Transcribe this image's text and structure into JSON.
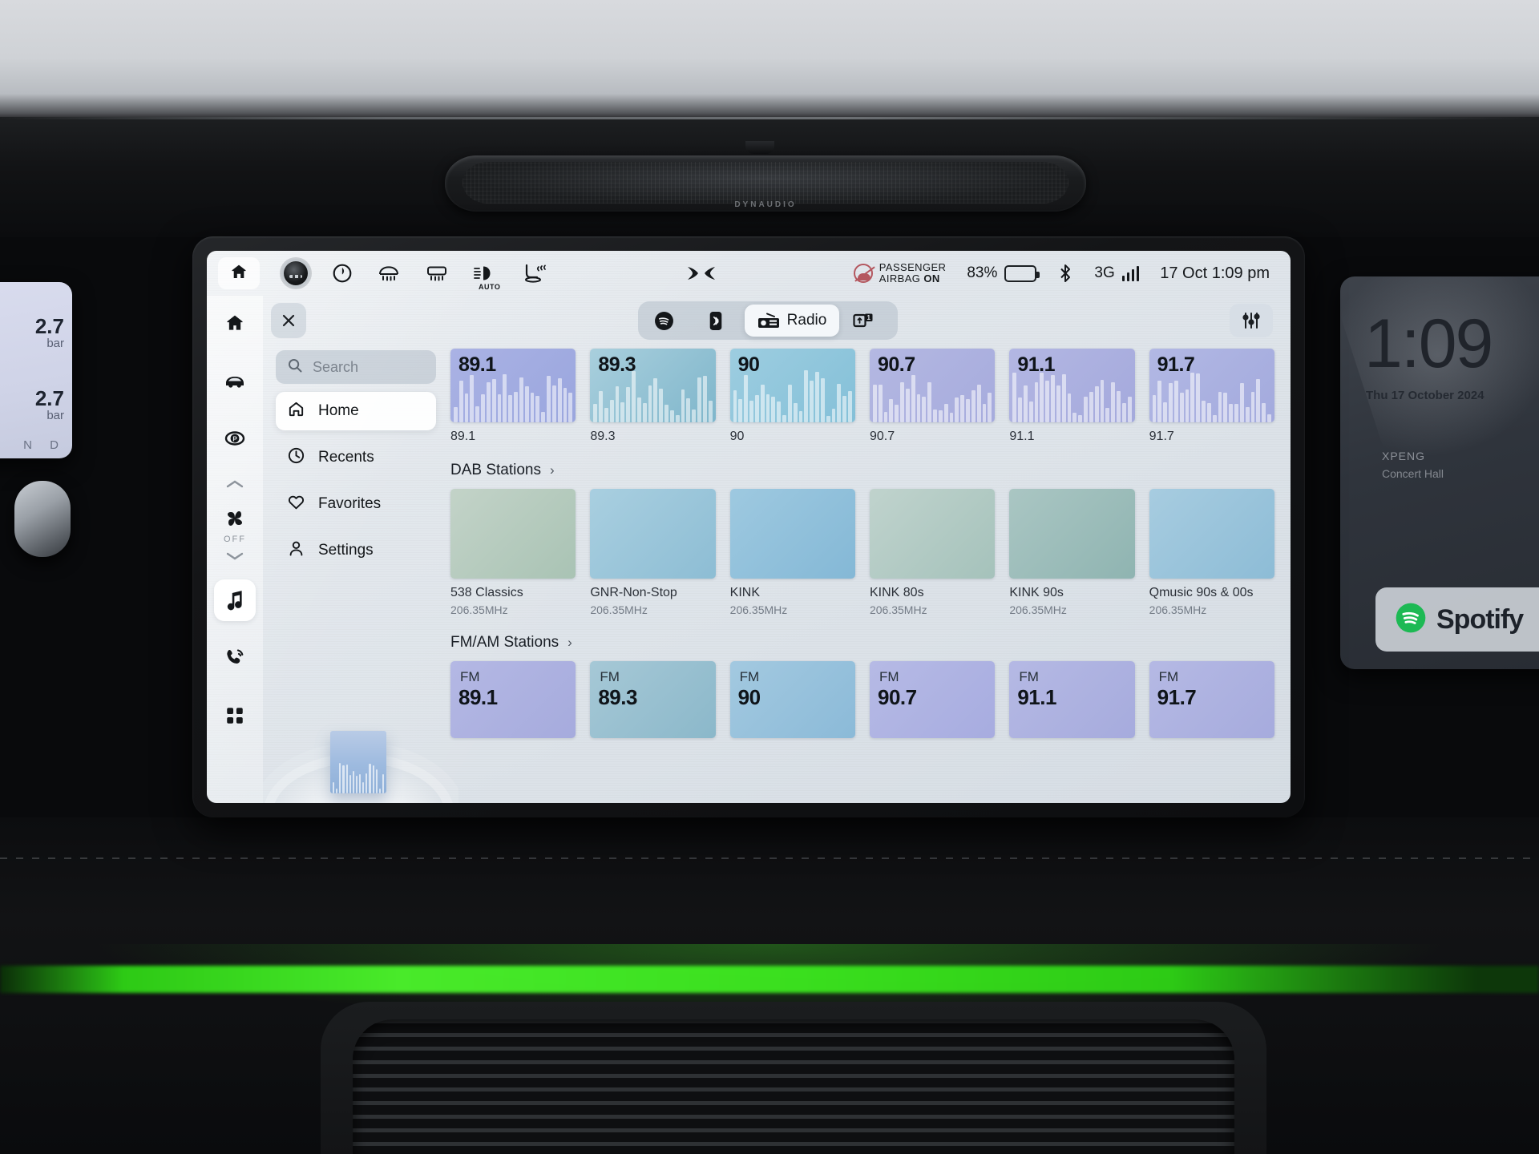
{
  "cabin": {
    "speaker_brand": "DYNAUDIO",
    "cluster": {
      "tpms_front": "2.7",
      "tpms_front_unit": "bar",
      "tpms_rear": "2.7",
      "tpms_rear_unit": "bar",
      "gear": "N  D"
    },
    "passenger_display": {
      "time": "1:09",
      "date": "Thu 17 October 2024",
      "brand": "XPENG",
      "subtitle": "Concert Hall",
      "spotify_label": "Spotify"
    }
  },
  "statusbar": {
    "camera_icon": "camera-icon",
    "home_icon": "home-icon",
    "climate_icons": [
      "recirculation-icon",
      "rear-defrost-icon",
      "front-defrost-icon",
      "auto-headlight-icon",
      "seat-heater-icon"
    ],
    "auto_label": "AUTO",
    "brand_logo": "xpeng-logo",
    "airbag_line1": "PASSENGER",
    "airbag_line2": "AIRBAG",
    "airbag_state": "ON",
    "battery_percent": "83%",
    "battery_level": 83,
    "bluetooth_icon": "bluetooth-icon",
    "network_label": "3G",
    "signal_bars": 4,
    "clock": "17 Oct 1:09 pm"
  },
  "rail": {
    "items": [
      {
        "name": "home",
        "icon": "home-icon",
        "active": false
      },
      {
        "name": "car",
        "icon": "car-icon",
        "active": false
      },
      {
        "name": "parking-brake",
        "icon": "parking-brake-icon",
        "active": false
      },
      {
        "name": "fan",
        "icon": "fan-icon",
        "active": false
      },
      {
        "name": "music",
        "icon": "music-note-icon",
        "active": true
      },
      {
        "name": "phone",
        "icon": "phone-icon",
        "active": false
      },
      {
        "name": "apps",
        "icon": "apps-grid-icon",
        "active": false
      }
    ],
    "fan_state": "OFF",
    "chevron_up": "chevron-up-icon",
    "chevron_down": "chevron-down-icon"
  },
  "panel": {
    "close_label": "✕",
    "tabs": [
      {
        "id": "spotify",
        "label": "",
        "icon": "spotify-icon",
        "active": false
      },
      {
        "id": "bluetooth",
        "label": "",
        "icon": "bluetooth-audio-icon",
        "active": false
      },
      {
        "id": "radio",
        "label": "Radio",
        "icon": "radio-icon",
        "active": true
      },
      {
        "id": "usb",
        "label": "",
        "icon": "usb-media-icon",
        "active": false
      }
    ],
    "equalizer_icon": "equalizer-icon"
  },
  "sidenav": {
    "search_placeholder": "Search",
    "search_icon": "search-icon",
    "items": [
      {
        "label": "Home",
        "icon": "home-outline-icon",
        "active": true
      },
      {
        "label": "Recents",
        "icon": "clock-icon",
        "active": false
      },
      {
        "label": "Favorites",
        "icon": "heart-icon",
        "active": false
      },
      {
        "label": "Settings",
        "icon": "person-icon",
        "active": false
      }
    ]
  },
  "presets": {
    "items": [
      {
        "freq": "89.1",
        "caption": "89.1",
        "color_a": "#aab2e4",
        "color_b": "#9aa6de"
      },
      {
        "freq": "89.3",
        "caption": "89.3",
        "color_a": "#a9cfdd",
        "color_b": "#7fb6cb"
      },
      {
        "freq": "90",
        "caption": "90",
        "color_a": "#9dcde0",
        "color_b": "#84c0d8"
      },
      {
        "freq": "90.7",
        "caption": "90.7",
        "color_a": "#b4b8e2",
        "color_b": "#a6abdd"
      },
      {
        "freq": "91.1",
        "caption": "91.1",
        "color_a": "#b3b7e3",
        "color_b": "#a4a9dc"
      },
      {
        "freq": "91.7",
        "caption": "91.7",
        "color_a": "#b2b8e4",
        "color_b": "#a3aadd"
      }
    ]
  },
  "dab": {
    "title": "DAB Stations",
    "chevron": "›",
    "items": [
      {
        "name": "538 Classics",
        "freq": "206.35MHz",
        "color_a": "#c3d3c8",
        "color_b": "#a9c3b4"
      },
      {
        "name": "GNR-Non-Stop",
        "freq": "206.35MHz",
        "color_a": "#a9cfe0",
        "color_b": "#8dbdd4"
      },
      {
        "name": "KINK",
        "freq": "206.35MHz",
        "color_a": "#9ec9e0",
        "color_b": "#84b8d6"
      },
      {
        "name": "KINK 80s",
        "freq": "206.35MHz",
        "color_a": "#c0d3cd",
        "color_b": "#a5c2bb"
      },
      {
        "name": "KINK 90s",
        "freq": "206.35MHz",
        "color_a": "#aac6c3",
        "color_b": "#8fb4b1"
      },
      {
        "name": "Qmusic 90s & 00s",
        "freq": "206.35MHz",
        "color_a": "#a7cce0",
        "color_b": "#8dbcd6"
      }
    ]
  },
  "fmam": {
    "title": "FM/AM Stations",
    "chevron": "›",
    "items": [
      {
        "band": "FM",
        "freq": "89.1",
        "color_a": "#b4b8e4",
        "color_b": "#a6abdd"
      },
      {
        "band": "FM",
        "freq": "89.3",
        "color_a": "#a6c8d6",
        "color_b": "#8bb8ca"
      },
      {
        "band": "FM",
        "freq": "90",
        "color_a": "#a3c9e0",
        "color_b": "#8bbad8"
      },
      {
        "band": "FM",
        "freq": "90.7",
        "color_a": "#b6bae5",
        "color_b": "#a7ace0"
      },
      {
        "band": "FM",
        "freq": "91.1",
        "color_a": "#b5b9e4",
        "color_b": "#a6abdd"
      },
      {
        "band": "FM",
        "freq": "91.7",
        "color_a": "#b5b9e4",
        "color_b": "#a6abdd"
      }
    ]
  }
}
